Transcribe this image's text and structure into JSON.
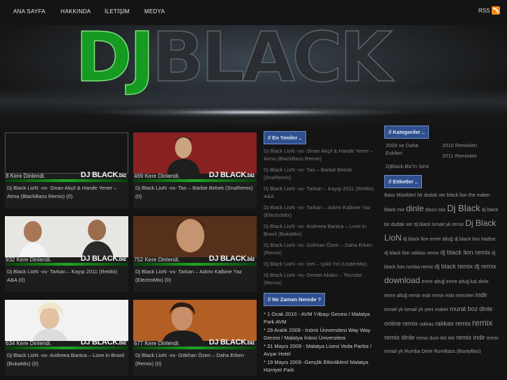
{
  "nav": {
    "items": [
      {
        "label": "ANA SAYFA"
      },
      {
        "label": "HAKKINDA"
      },
      {
        "label": "İLETİŞİM"
      },
      {
        "label": "MEDYA"
      }
    ],
    "rss_label": "RSS"
  },
  "header": {
    "logo_dj": "DJ",
    "logo_black": "BLACK"
  },
  "cards": [
    {
      "views": "8 Kere Dinlendi.",
      "title": "Dj Black LioN -vs- Sinan Akçil & Hande Yener – Atma (BlackBass Remix) (0)"
    },
    {
      "views": "469 Kere Dinlendi.",
      "title": "Dj Black LioN -vs- Tan – Barbie Bebek (SnaRemix) (0)"
    },
    {
      "views": "932 Kere Dinlendi.",
      "title": "Dj Black LioN -vs- Tarkan – Kayıp 2011 (ReMix) A&A (0)"
    },
    {
      "views": "752 Kere Dinlendi.",
      "title": "Dj Black LioN -vs- Tarkan – Adımı Kalbine Yaz (ElectroMix) (0)"
    },
    {
      "views": "634 Kere Dinlendi.",
      "title": "Dj Black LioN -vs- Andreea Banica – Love in Brasil (BukaMix) (0)"
    },
    {
      "views": "677 Kere Dinlendi.",
      "title": "Dj Black LioN -vs- Gökhan Özen – Daha Erken (Remix) (0)"
    }
  ],
  "card_brand": {
    "name": "DJ BLACK",
    "suffix": ".biz"
  },
  "latest": {
    "heading": "// En Yeniler ..",
    "items": [
      "Dj Black LioN -vs- Sinan Akçil & Hande Yener – Atma (BlackBass Remix)",
      "Dj Black LioN -vs- Tan – Barbie Bebek (SnaRemix)",
      "Dj Black LioN -vs- Tarkan – Kayıp 2011 (ReMix) A&A",
      "Dj Black LioN -vs- Tarkan – Adımı Kalbine Yaz (ElectroMix)",
      "Dj Black LioN -vs- Andreea Banica – Love in Brasil (BukaMix)",
      "Dj Black LioN -vs- Gökhan Özen – Daha Erken (Remix)",
      "Dj Black LioN -vs- İzel – Işıklı Yol (UnderMix)",
      "Dj Black LioN -vs- Demet Akalın – Tecrube (Remix)"
    ]
  },
  "where": {
    "heading": "// Ne Zaman Nerede ?",
    "items": [
      "* 1 Ocak 2010 - AVM Yılbaşı Gecesi / Malatya Park AVM",
      "* 29 Aralık 2009 - İnönü Üniversitesi Way Way Gecesi / Malatya İnönü Üniversitesi",
      "* 31 Mayıs 2009 - Malatya Lisesi Veda Partisi / Avşar Hotel",
      "* 19 Mayıs 2009 -Gençlik Etkinlikleri/ Malatya Hürriyet Park"
    ]
  },
  "categories": {
    "heading": "// Kategoriler ..",
    "items": [
      "2009 ve Daha Eskileri",
      "2010 Remixleri",
      "2011 Remixleri",
      "DjBlack.Biz'in Sesi"
    ]
  },
  "tags": {
    "heading": "// Etiketler ..",
    "items": [
      {
        "text": "Bass Müzikleri",
        "size": "t1"
      },
      {
        "text": "bir dudak ver black lion the maker",
        "size": "t1"
      },
      {
        "text": "black mix",
        "size": "t1"
      },
      {
        "text": "dinle",
        "size": "t3"
      },
      {
        "text": "disco mix",
        "size": "t1"
      },
      {
        "text": "Dj Black",
        "size": "t4"
      },
      {
        "text": "dj black bir dudak ver",
        "size": "t1"
      },
      {
        "text": "dj black ismail yk remix",
        "size": "t1"
      },
      {
        "text": "Dj Black LioN",
        "size": "t3"
      },
      {
        "text": "dj black lion emre altuğ",
        "size": "t1"
      },
      {
        "text": "dj black lion hadise",
        "size": "t1"
      },
      {
        "text": "dj black lion rakkas remix",
        "size": "t1"
      },
      {
        "text": "dj black lion remix",
        "size": "t2"
      },
      {
        "text": "dj black lion rumba remix",
        "size": "t1"
      },
      {
        "text": "dj black remix",
        "size": "t2"
      },
      {
        "text": "dj remix",
        "size": "t2"
      },
      {
        "text": "download",
        "size": "t3"
      },
      {
        "text": "emre altuğ",
        "size": "t1"
      },
      {
        "text": "emre altuğ kal",
        "size": "t1"
      },
      {
        "text": "dinle emre altuğ remix",
        "size": "t1"
      },
      {
        "text": "eski remix",
        "size": "t1"
      },
      {
        "text": "eski remixleri",
        "size": "t1"
      },
      {
        "text": "indir",
        "size": "t2"
      },
      {
        "text": "ismail yk",
        "size": "t1"
      },
      {
        "text": "ismail yk yeni maker",
        "size": "t1"
      },
      {
        "text": "murat boz",
        "size": "t2"
      },
      {
        "text": "dinle online",
        "size": "t2"
      },
      {
        "text": "remix",
        "size": "t2"
      },
      {
        "text": "rakkas",
        "size": "t1"
      },
      {
        "text": "rakkas remix",
        "size": "t2"
      },
      {
        "text": "remix",
        "size": "t3"
      },
      {
        "text": "remix dinle",
        "size": "t2"
      },
      {
        "text": "remix dum tek tek",
        "size": "t1"
      },
      {
        "text": "remix indir",
        "size": "t2"
      },
      {
        "text": "remix ismail yk",
        "size": "t1"
      },
      {
        "text": "Rumba Dinle",
        "size": "t1"
      },
      {
        "text": "RumBass (BootyBas)",
        "size": "t1"
      }
    ]
  },
  "colors": {
    "accent_blue": "#2f4f8f",
    "brand_green": "#1da822",
    "rss_orange": "#f48a1b"
  }
}
